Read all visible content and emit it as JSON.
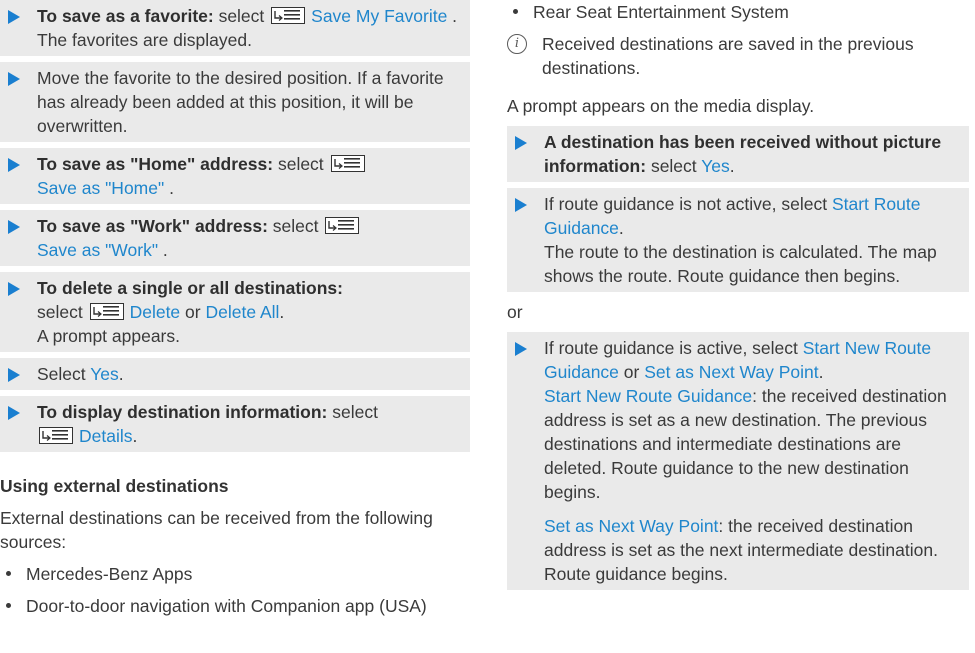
{
  "left": {
    "step1": {
      "bold": "To save as a favorite:",
      "text": " select ",
      "link": "Save My Favorite",
      "after": " .",
      "result": "The favorites are displayed."
    },
    "step2": {
      "text": "Move the favorite to the desired position. If a favorite has already been added at this position, it will be overwritten."
    },
    "step3": {
      "bold": "To save as \"Home\" address:",
      "text": " select ",
      "link": "Save as \"Home\"",
      "after": " ."
    },
    "step4": {
      "bold": "To save as \"Work\" address:",
      "text": " select ",
      "link": "Save as \"Work\"",
      "after": " ."
    },
    "step5": {
      "bold": "To delete a single or all destinations:",
      "text": " select ",
      "link1": "Delete",
      "or": " or ",
      "link2": "Delete All",
      "after": ".",
      "result": "A prompt appears."
    },
    "step6": {
      "text": "Select ",
      "link": "Yes",
      "after": "."
    },
    "step7": {
      "bold": "To display destination information:",
      "text": " select ",
      "link": "Details",
      "after": "."
    },
    "heading": "Using external destinations",
    "intro": "External destinations can be received from the following sources:",
    "sources": [
      "Mercedes-Benz Apps",
      "Door-to-door navigation with Companion app (USA)"
    ]
  },
  "right": {
    "source_last": "Rear Seat Entertainment System",
    "info": "Received destinations are saved in the previous destinations.",
    "prompt": "A prompt appears on the media display.",
    "stepA": {
      "bold": "A destination has been received without picture information:",
      "text": " select ",
      "link": "Yes",
      "after": "."
    },
    "stepB": {
      "text": "If route guidance is not active, select ",
      "link": "Start Route Guidance",
      "after": ".",
      "result": "The route to the destination is calculated. The map shows the route. Route guidance then begins."
    },
    "or": "or",
    "stepC": {
      "text": "If route guidance is active, select ",
      "link1": "Start New Route Guidance",
      "or": " or ",
      "link2": "Set as Next Way Point",
      "after": ".",
      "desc1_link": "Start New Route Guidance",
      "desc1_text": ": the received destination address is set as a new destination. The previous destinations and intermediate destinations are deleted. Route guidance to the new destination begins.",
      "desc2_link": "Set as Next Way Point",
      "desc2_text": ": the received destination address is set as the next intermediate destination. Route guidance begins."
    }
  },
  "icons": {
    "menu": "menu-list-icon",
    "info": "info-icon",
    "arrow": "step-arrow-icon"
  },
  "colors": {
    "link": "#1f86cc",
    "arrow": "#1a7fd0",
    "step_bg": "#eaeaea"
  }
}
